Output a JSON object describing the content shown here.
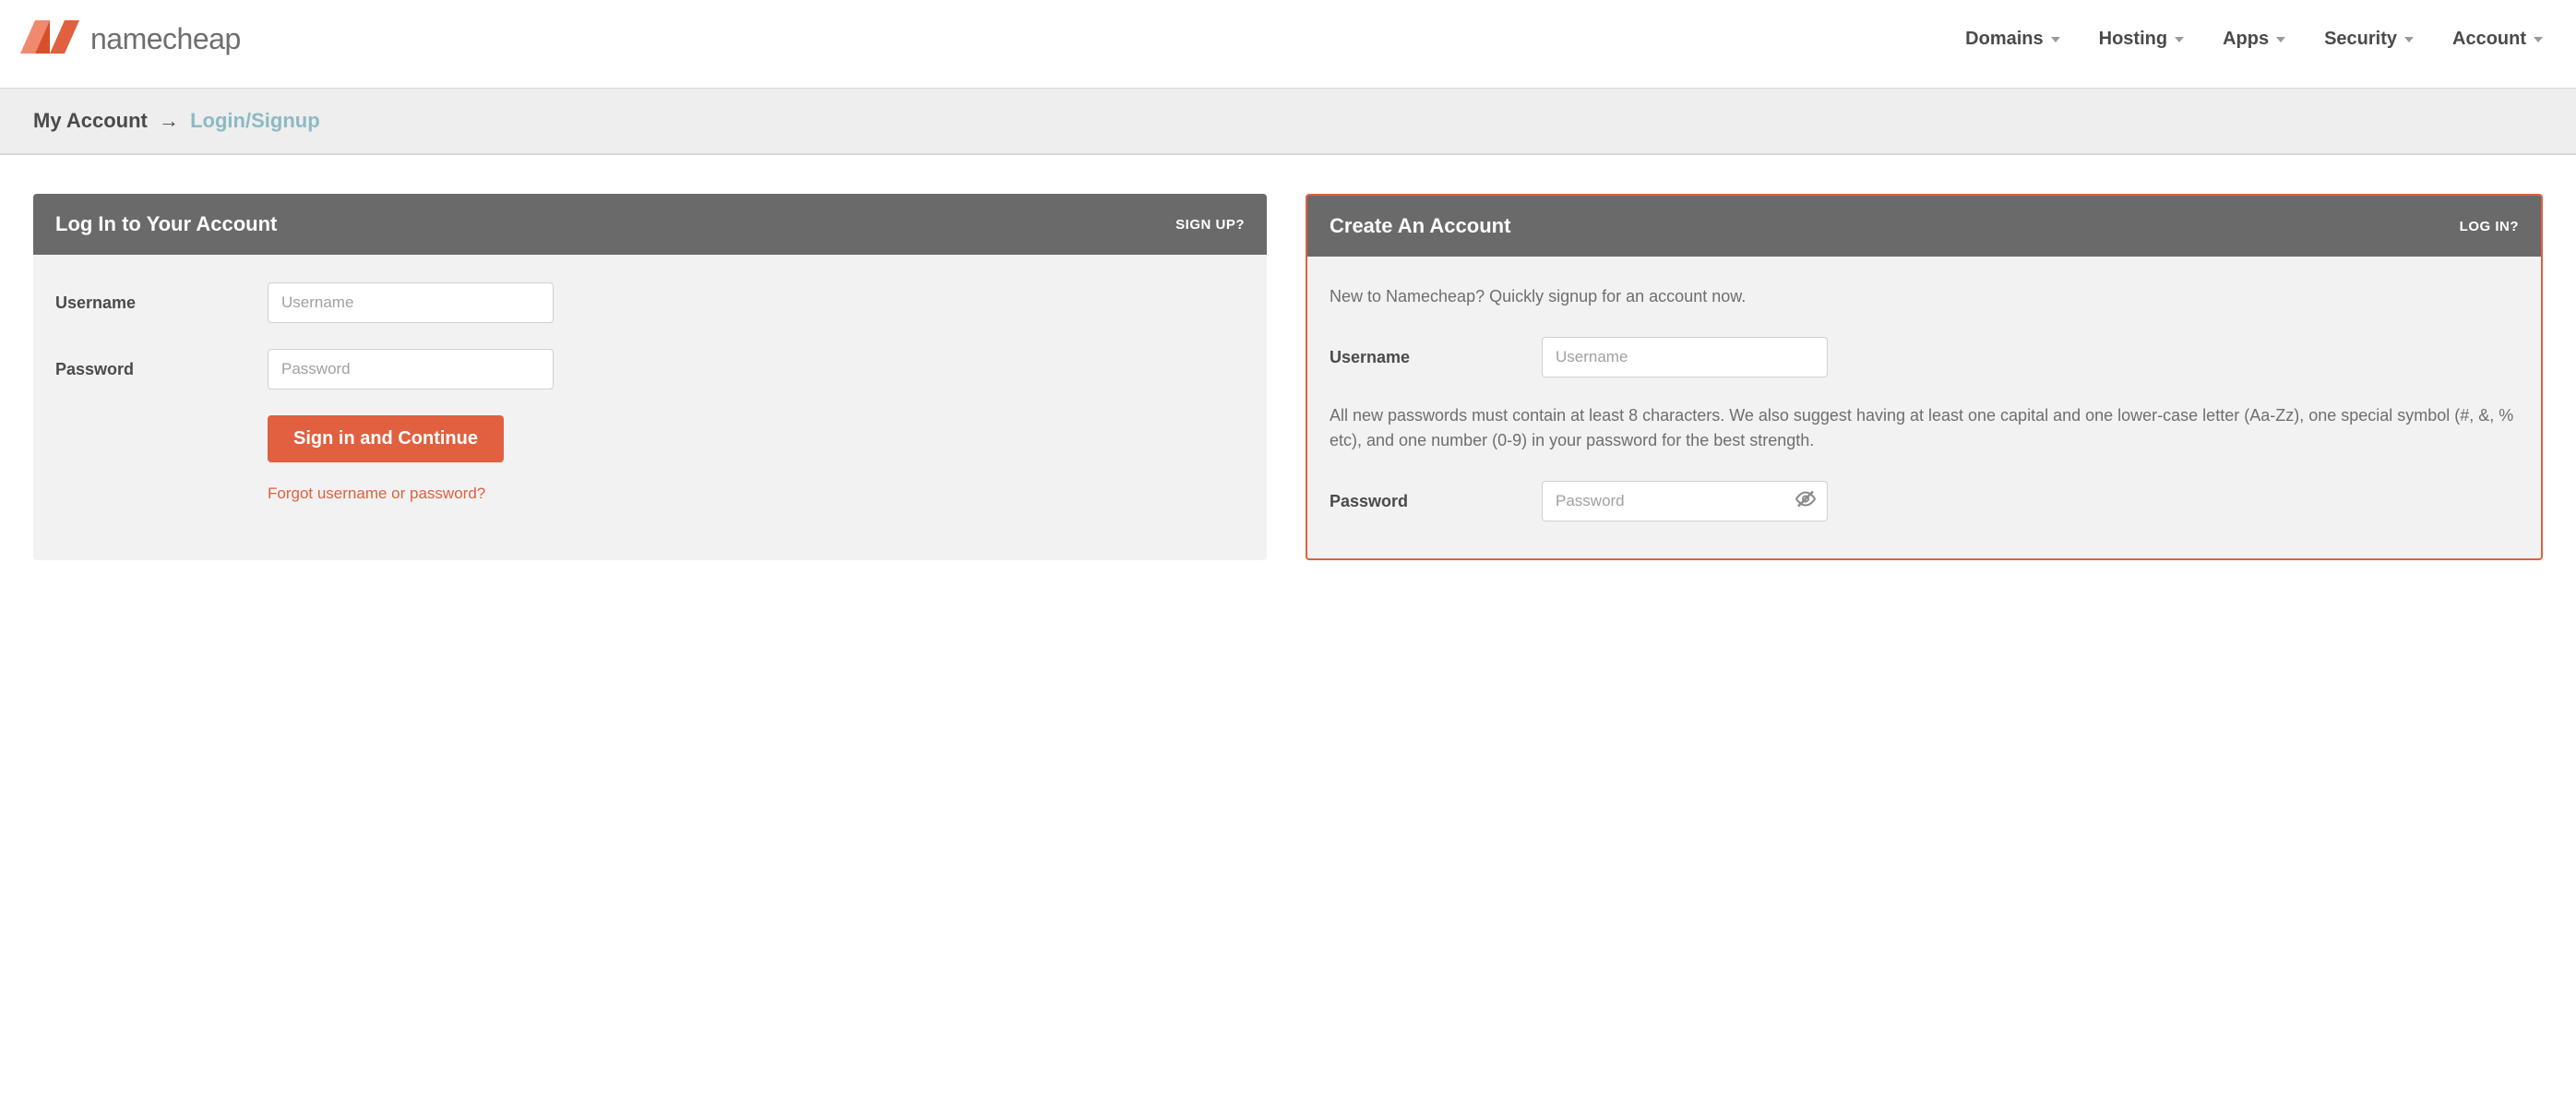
{
  "brand": {
    "name": "namecheap"
  },
  "nav": {
    "items": [
      {
        "label": "Domains"
      },
      {
        "label": "Hosting"
      },
      {
        "label": "Apps"
      },
      {
        "label": "Security"
      },
      {
        "label": "Account"
      }
    ]
  },
  "breadcrumb": {
    "root": "My Account",
    "arrow": "→",
    "current": "Login/Signup"
  },
  "login_panel": {
    "title": "Log In to Your Account",
    "alt_link": "SIGN UP?",
    "username_label": "Username",
    "username_placeholder": "Username",
    "password_label": "Password",
    "password_placeholder": "Password",
    "submit_label": "Sign in and Continue",
    "forgot_label": "Forgot username or password?"
  },
  "signup_panel": {
    "title": "Create An Account",
    "alt_link": "LOG IN?",
    "intro_text": "New to Namecheap? Quickly signup for an account now.",
    "username_label": "Username",
    "username_placeholder": "Username",
    "password_hint": "All new passwords must contain at least 8 characters. We also suggest having at least one capital and one lower-case letter (Aa-Zz), one special symbol (#, &, % etc), and one number (0-9) in your password for the best strength.",
    "password_label": "Password",
    "password_placeholder": "Password"
  }
}
